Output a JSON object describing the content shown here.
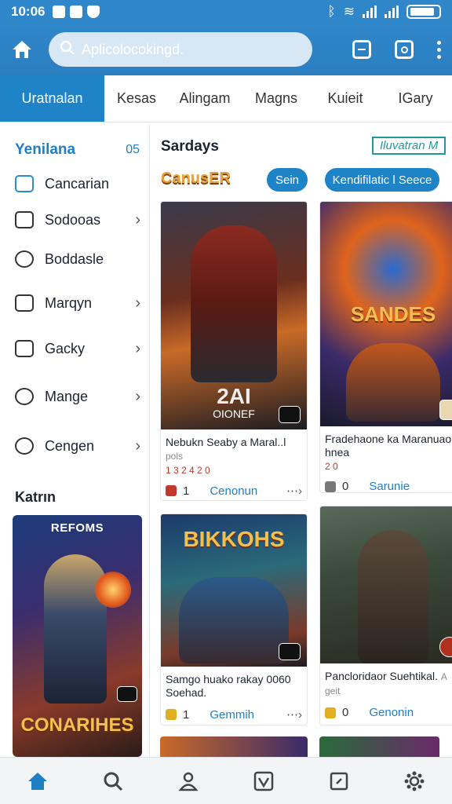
{
  "status": {
    "time": "10:06"
  },
  "appbar": {
    "search_placeholder": "Aplicolocokingd."
  },
  "tabs": [
    {
      "label": "Uratnalan",
      "active": true
    },
    {
      "label": "Kesas"
    },
    {
      "label": "Alingam"
    },
    {
      "label": "Magns"
    },
    {
      "label": "Kuieit"
    },
    {
      "label": "IGary"
    }
  ],
  "sidebar": {
    "title": "Yenilana",
    "count": "05",
    "items": [
      {
        "label": "Cancarian",
        "icon": "inbox-icon",
        "chevron": false
      },
      {
        "label": "Sodooas",
        "icon": "folder-icon",
        "chevron": true
      },
      {
        "label": "Boddasle",
        "icon": "person-icon",
        "chevron": false
      },
      {
        "label": "Marqyn",
        "icon": "folder-icon",
        "chevron": true
      },
      {
        "label": "Gacky",
        "icon": "card-icon",
        "chevron": true
      },
      {
        "label": "Mange",
        "icon": "chat-icon",
        "chevron": true
      },
      {
        "label": "Cengen",
        "icon": "clock-icon",
        "chevron": true
      }
    ],
    "section": "Katrın",
    "card": {
      "badge": "REFOMS",
      "logo": "CONARIHES"
    }
  },
  "main": {
    "heading": "Sardays",
    "link": "Iluvatran M",
    "promo_logo": "CanusER",
    "pill_1": "Sein",
    "pill_2": "Kendifilatic l Seece",
    "cards": [
      {
        "banner": "",
        "overlay": "2AI",
        "sub": "OIONEF",
        "title": "Nebukn Seaby a Maral..l",
        "tag": "pols",
        "meta": "1 3 2 4 2 0",
        "count": "1",
        "action": "Cenonun"
      },
      {
        "banner": "",
        "overlay": "SANDES",
        "sub": "",
        "title": "Fradehaone ka Maranuao hnea",
        "tag": "",
        "meta": "2 0",
        "count": "0",
        "action": "Sarunie"
      },
      {
        "banner": "BIKKOHS",
        "overlay": "",
        "sub": "",
        "title": "Samgo huako rakay 0060 Soehad.",
        "tag": "",
        "meta": "",
        "count": "1",
        "action": "Gemmih"
      },
      {
        "banner": "",
        "overlay": "",
        "sub": "",
        "title": "Pancloridaor Suehtikal.",
        "tag": "A geit",
        "meta": "",
        "count": "0",
        "action": "Genonin"
      }
    ]
  },
  "bottom_nav": [
    {
      "icon": "home-icon"
    },
    {
      "icon": "search-icon"
    },
    {
      "icon": "people-icon"
    },
    {
      "icon": "check-icon"
    },
    {
      "icon": "clip-icon"
    },
    {
      "icon": "settings-icon"
    }
  ]
}
